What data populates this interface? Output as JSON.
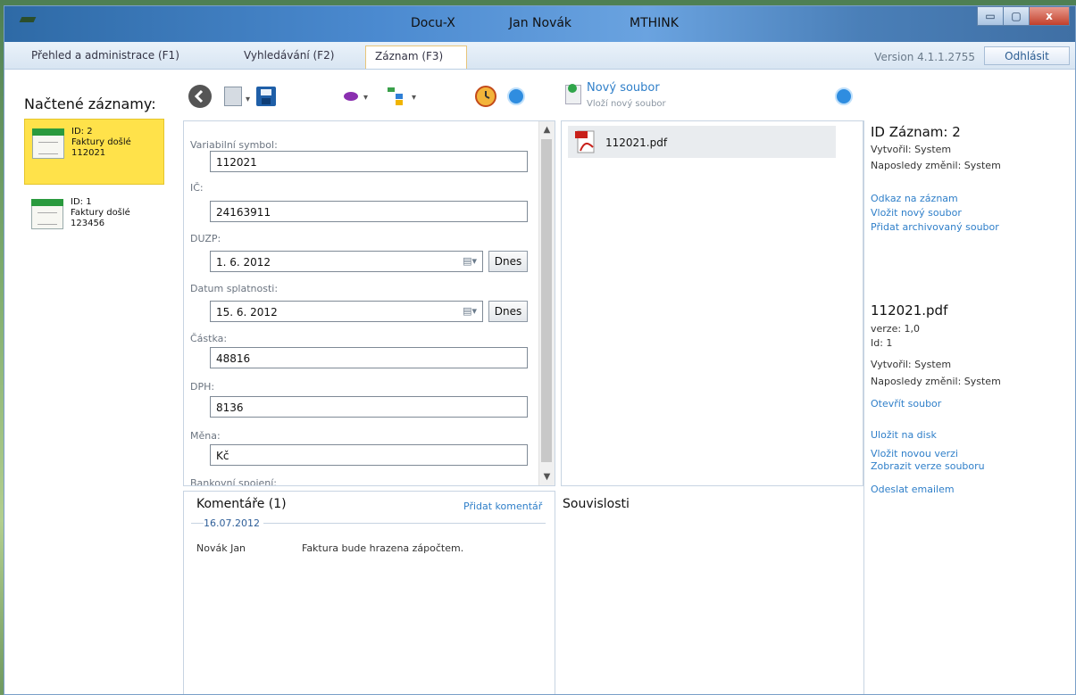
{
  "window": {
    "titles": [
      "Docu-X",
      "Jan Novák",
      "MTHINK"
    ],
    "controls": {
      "minimize": "▭",
      "maximize": "▢",
      "close": "x"
    }
  },
  "tabs": [
    {
      "label": "Přehled a administrace (F1)"
    },
    {
      "label": "Vyhledávání (F2)"
    },
    {
      "label": "Záznam (F3)",
      "active": true
    }
  ],
  "version": "Version 4.1.1.2755",
  "logout_label": "Odhlásit",
  "loaded_records": {
    "title": "Načtené záznamy:",
    "items": [
      {
        "id": "ID: 2",
        "type": "Faktury došlé",
        "number": "112021",
        "selected": true
      },
      {
        "id": "ID: 1",
        "type": "Faktury došlé",
        "number": "123456",
        "selected": false
      }
    ]
  },
  "new_file": {
    "label": "Nový soubor",
    "sublabel": "Vloží nový soubor"
  },
  "form": {
    "fields": [
      {
        "label": "Variabilní symbol:",
        "value": "112021"
      },
      {
        "label": "IČ:",
        "value": "24163911"
      },
      {
        "label": "DUZP:",
        "value": "1.  6. 2012",
        "today": "Dnes"
      },
      {
        "label": "Datum splatnosti:",
        "value": "15.  6. 2012",
        "today": "Dnes"
      },
      {
        "label": "Částka:",
        "value": "48816"
      },
      {
        "label": "DPH:",
        "value": "8136"
      },
      {
        "label": "Měna:",
        "value": "Kč"
      },
      {
        "label": "Bankovní spojení:",
        "value": ""
      }
    ]
  },
  "files": [
    {
      "name": "112021.pdf"
    }
  ],
  "comments": {
    "title": "Komentáře (1)",
    "add_label": "Přidat komentář",
    "items": [
      {
        "date": "16.07.2012",
        "author": "Novák Jan",
        "text": "Faktura bude hrazena zápočtem."
      }
    ]
  },
  "related_title": "Souvislosti",
  "record_info": {
    "title": "ID Záznam: 2",
    "created": "Vytvořil: System",
    "modified": "Naposledy změnil: System",
    "links": [
      "Odkaz na záznam",
      "Vložit nový soubor",
      "Přidat archivovaný soubor"
    ]
  },
  "file_info": {
    "title": "112021.pdf",
    "version": "verze: 1,0",
    "id": "Id: 1",
    "created": "Vytvořil: System",
    "modified": "Naposledy změnil: System",
    "links": [
      "Otevřít soubor",
      "Uložit na disk",
      "Vložit novou verzi",
      "Zobrazit verze souboru",
      "Odeslat emailem"
    ]
  }
}
